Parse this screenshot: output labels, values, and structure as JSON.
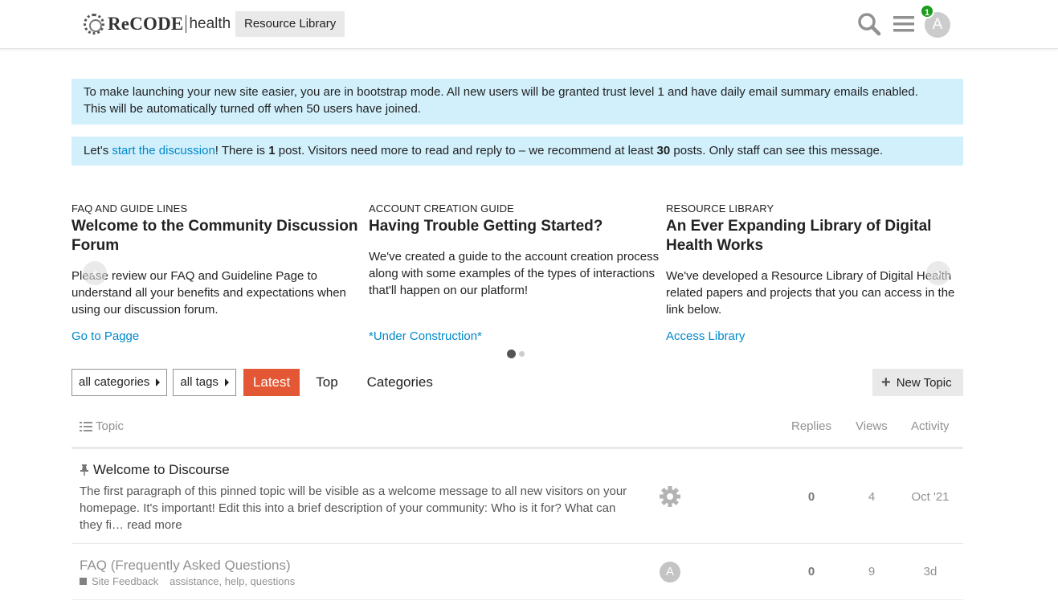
{
  "header": {
    "logo_text": "ReCODE",
    "logo_sub": "health",
    "resource_library_label": "Resource Library",
    "notification_count": "1",
    "avatar_letter": "A"
  },
  "notices": {
    "bootstrap_line1": "To make launching your new site easier, you are in bootstrap mode. All new users will be granted trust level 1 and have daily email summary emails enabled.",
    "bootstrap_line2": "This will be automatically turned off when 50 users have joined.",
    "discussion_prefix": "Let's ",
    "discussion_link": "start the discussion",
    "discussion_mid1": "! There is ",
    "discussion_post_count": "1",
    "discussion_mid2": " post. Visitors need more to read and reply to – we recommend at least ",
    "discussion_recommend_count": "30",
    "discussion_suffix": " posts. Only staff can see this message."
  },
  "banner": {
    "cards": [
      {
        "category": "FAQ AND GUIDE LINES",
        "title": "Welcome to the Community Discussion Forum",
        "body": "Please review our FAQ and Guideline Page to understand all your benefits and expectations when using our discussion forum.",
        "link": "Go to Pagge"
      },
      {
        "category": "ACCOUNT CREATION GUIDE",
        "title": "Having Trouble Getting Started?",
        "body": "We've created a guide to the account creation process along with some examples of the types of interactions that'll happen on our platform!",
        "link": "*Under Construction*"
      },
      {
        "category": "RESOURCE LIBRARY",
        "title": "An Ever Expanding Library of Digital Health Works",
        "body": "We've developed a Resource Library of Digital Health related papers and projects that you can access in the link below.",
        "link": "Access Library"
      }
    ],
    "arrow_left": "‹",
    "arrow_right": "›"
  },
  "nav": {
    "categories_dropdown": "all categories",
    "tags_dropdown": "all tags",
    "latest": "Latest",
    "top": "Top",
    "categories": "Categories",
    "new_topic": "New Topic"
  },
  "table": {
    "col_topic": "Topic",
    "col_replies": "Replies",
    "col_views": "Views",
    "col_activity": "Activity"
  },
  "topics": [
    {
      "title": "Welcome to Discourse",
      "excerpt": "The first paragraph of this pinned topic will be visible as a welcome message to all new visitors on your homepage. It's important! Edit this into a brief description of your community: Who is it for? What can they fi…",
      "read_more": "read more",
      "replies": "0",
      "views": "4",
      "activity": "Oct '21"
    },
    {
      "title": "FAQ (Frequently Asked Questions)",
      "category": "Site Feedback",
      "tags": "assistance, help, questions",
      "poster_letter": "A",
      "replies": "0",
      "views": "9",
      "activity": "3d"
    }
  ],
  "colors": {
    "accent": "#e45735",
    "link": "#0088cc",
    "notice_bg": "#d1f0fc",
    "badge_green": "#1b9c1b"
  }
}
